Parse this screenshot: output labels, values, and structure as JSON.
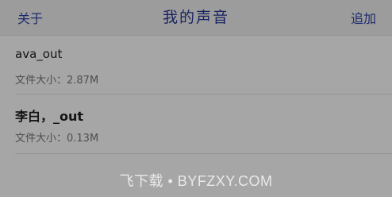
{
  "nav": {
    "left_label": "关于",
    "title": "我的声音",
    "right_label": "追加"
  },
  "recordings": [
    {
      "name": "ava_out",
      "size_text": "文件大小：2.87M"
    },
    {
      "name": "李白，_out",
      "size_text": "文件大小：0.13M"
    }
  ],
  "watermark": "飞下载 • BYFZXY.COM",
  "colors": {
    "background": "#a6a6a6",
    "nav_background": "#9c9c9c",
    "nav_text": "#1e2a6e",
    "title_text": "#182360",
    "separator": "#939393"
  }
}
